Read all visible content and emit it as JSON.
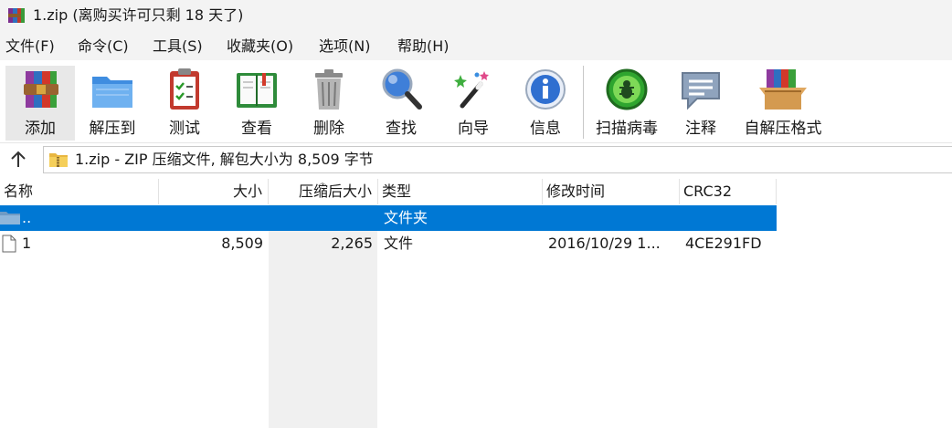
{
  "window": {
    "title": "1.zip (离购买许可只剩 18 天了)"
  },
  "menu": [
    {
      "label": "文件(F)"
    },
    {
      "label": "命令(C)"
    },
    {
      "label": "工具(S)"
    },
    {
      "label": "收藏夹(O)"
    },
    {
      "label": "选项(N)"
    },
    {
      "label": "帮助(H)"
    }
  ],
  "toolbar": [
    {
      "label": "添加",
      "icon": "books-add-icon"
    },
    {
      "label": "解压到",
      "icon": "folder-extract-icon"
    },
    {
      "label": "测试",
      "icon": "clipboard-check-icon"
    },
    {
      "label": "查看",
      "icon": "open-book-icon"
    },
    {
      "label": "删除",
      "icon": "trash-can-icon"
    },
    {
      "label": "查找",
      "icon": "magnifier-icon"
    },
    {
      "label": "向导",
      "icon": "magic-wand-icon"
    },
    {
      "label": "信息",
      "icon": "info-icon"
    },
    {
      "label": "扫描病毒",
      "icon": "virus-scan-icon"
    },
    {
      "label": "注释",
      "icon": "comment-icon"
    },
    {
      "label": "自解压格式",
      "icon": "sfx-box-icon"
    }
  ],
  "address": {
    "text": "1.zip - ZIP 压缩文件, 解包大小为 8,509 字节"
  },
  "columns": [
    "名称",
    "大小",
    "压缩后大小",
    "类型",
    "修改时间",
    "CRC32"
  ],
  "rows": [
    {
      "name": "..",
      "size": "",
      "packed": "",
      "type": "文件夹",
      "modified": "",
      "crc": "",
      "selected": true
    },
    {
      "name": "1",
      "size": "8,509",
      "packed": "2,265",
      "type": "文件",
      "modified": "2016/10/29 1...",
      "crc": "4CE291FD",
      "selected": false
    }
  ],
  "colors": {
    "selection": "#0078d4",
    "chrome": "#f3f3f3",
    "sorted_column": "#f0f0f0"
  }
}
